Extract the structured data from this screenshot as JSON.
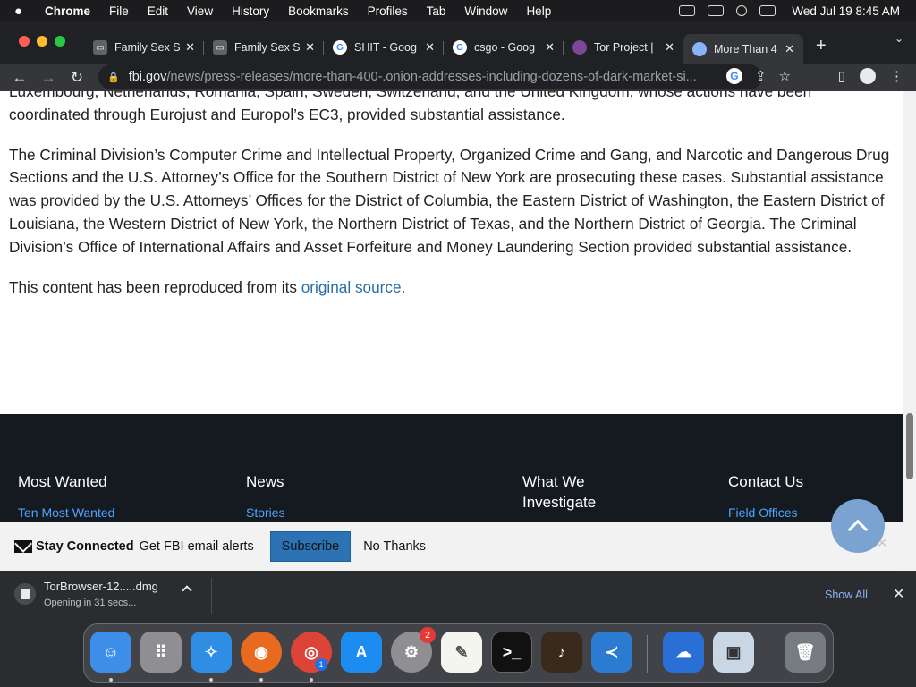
{
  "menubar": {
    "app": "Chrome",
    "items": [
      "File",
      "Edit",
      "View",
      "History",
      "Bookmarks",
      "Profiles",
      "Tab",
      "Window",
      "Help"
    ],
    "clock": "Wed Jul 19  8:45 AM"
  },
  "tabs": [
    {
      "title": "Family Sex S",
      "icon": "site-icon"
    },
    {
      "title": "Family Sex S",
      "icon": "site-icon"
    },
    {
      "title": "SHIT - Goog",
      "icon": "google-icon"
    },
    {
      "title": "csgo - Goog",
      "icon": "google-icon"
    },
    {
      "title": "Tor Project |",
      "icon": "tor-icon"
    },
    {
      "title": "More Than 4",
      "icon": "globe-icon"
    }
  ],
  "toolbar": {
    "url_host": "fbi.gov",
    "url_path": "/news/press-releases/more-than-400-.onion-addresses-including-dozens-of-dark-market-si..."
  },
  "article": {
    "p1": "Luxembourg, Netherlands, Romania, Spain, Sweden, Switzerland, and the United Kingdom, whose actions have been coordinated through Eurojust and Europol’s EC3, provided substantial assistance.",
    "p2": "The Criminal Division’s Computer Crime and Intellectual Property, Organized Crime and Gang, and Narcotic and Dangerous Drug Sections and the U.S. Attorney’s Office for the Southern District of New York are prosecuting these cases. Substantial assistance was provided by the U.S. Attorneys’ Offices for the District of Columbia, the Eastern District of Washington, the Eastern District of Louisiana, the Western District of New York, the Northern District of Texas, and the Northern District of Georgia. The Criminal Division’s Office of International Affairs and Asset Forfeiture and Money Laundering Section provided substantial assistance.",
    "p3_prefix": "This content has been reproduced from its ",
    "p3_link": "original source",
    "p3_suffix": "."
  },
  "footer": {
    "col1": {
      "heading": "Most Wanted",
      "link": "Ten Most Wanted"
    },
    "col2": {
      "heading": "News",
      "link": "Stories"
    },
    "col3": {
      "heading": "What We Investigate"
    },
    "col4": {
      "heading": "Contact Us",
      "link": "Field Offices"
    }
  },
  "stay_connected": {
    "title": "Stay Connected",
    "text": "Get FBI email alerts",
    "subscribe": "Subscribe",
    "no_thanks": "No Thanks"
  },
  "download": {
    "filename": "TorBrowser-12.....dmg",
    "status": "Opening in 31 secs...",
    "show_all": "Show All"
  },
  "dock": {
    "settings_badge": "2",
    "chrome_badge": "1"
  }
}
